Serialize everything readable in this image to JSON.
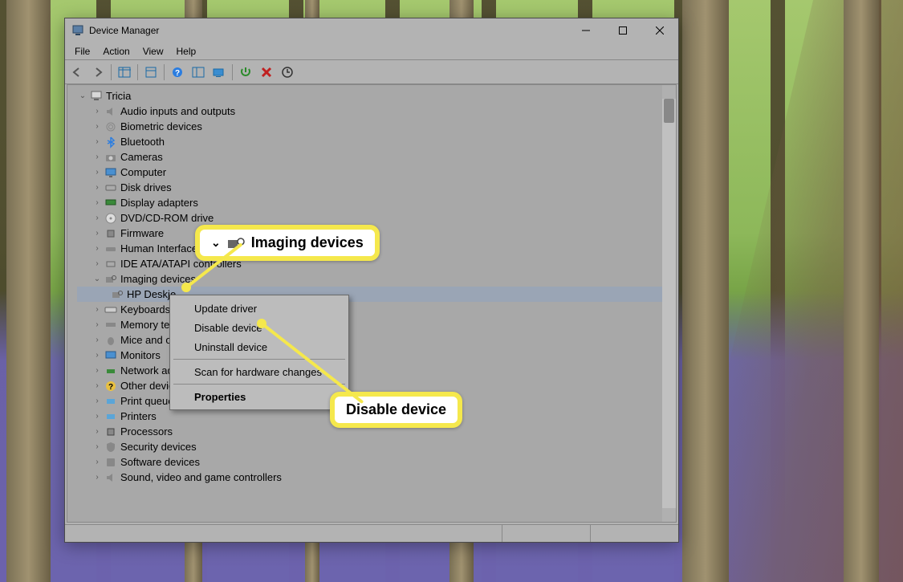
{
  "window": {
    "title": "Device Manager"
  },
  "menus": {
    "file": "File",
    "action": "Action",
    "view": "View",
    "help": "Help"
  },
  "tree": {
    "root": "Tricia",
    "items": {
      "audio": "Audio inputs and outputs",
      "biometric": "Biometric devices",
      "bluetooth": "Bluetooth",
      "cameras": "Cameras",
      "computer": "Computer",
      "disk": "Disk drives",
      "display": "Display adapters",
      "dvd": "DVD/CD-ROM drive",
      "firmware": "Firmware",
      "hid": "Human Interface Devices",
      "ide": "IDE ATA/ATAPI controllers",
      "imaging": "Imaging devices",
      "imaging_child": "HP Deskje",
      "keyboards": "Keyboards",
      "memory": "Memory tech",
      "mice": "Mice and oth",
      "monitors": "Monitors",
      "network": "Network adap",
      "other": "Other devices",
      "printq": "Print queues",
      "printers": "Printers",
      "processors": "Processors",
      "security": "Security devices",
      "software": "Software devices",
      "sound": "Sound, video and game controllers"
    }
  },
  "context_menu": {
    "update": "Update driver",
    "disable": "Disable device",
    "uninstall": "Uninstall device",
    "scan": "Scan for hardware changes",
    "properties": "Properties"
  },
  "callouts": {
    "imaging": "Imaging devices",
    "disable": "Disable device"
  },
  "icons": {
    "chevron_right": "›",
    "chevron_down": "⌄"
  }
}
